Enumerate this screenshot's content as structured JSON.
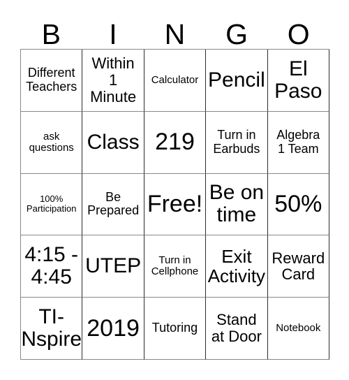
{
  "card": {
    "title_letters": [
      "B",
      "I",
      "N",
      "G",
      "O"
    ],
    "columns": 5,
    "rows": 5,
    "free_space_label": "Free!",
    "border_color": "#2b2b2b",
    "background_color": "#ffffff",
    "text_color": "#000000",
    "cells": [
      {
        "text": "Different\nTeachers",
        "size": "fs-md"
      },
      {
        "text": "Within\n1\nMinute",
        "size": "fs-lg"
      },
      {
        "text": "Calculator",
        "size": "fs-sm"
      },
      {
        "text": "Pencil",
        "size": "fs-xxl"
      },
      {
        "text": "El\nPaso",
        "size": "fs-xxl"
      },
      {
        "text": "ask\nquestions",
        "size": "fs-sm"
      },
      {
        "text": "Class",
        "size": "fs-xxl"
      },
      {
        "text": "219",
        "size": "fs-huge"
      },
      {
        "text": "Turn in\nEarbuds",
        "size": "fs-md"
      },
      {
        "text": "Algebra\n1 Team",
        "size": "fs-md"
      },
      {
        "text": "100%\nParticipation",
        "size": "fs-xs"
      },
      {
        "text": "Be\nPrepared",
        "size": "fs-md"
      },
      {
        "text": "Free!",
        "size": "fs-huge"
      },
      {
        "text": "Be on\ntime",
        "size": "fs-xxl"
      },
      {
        "text": "50%",
        "size": "fs-huge"
      },
      {
        "text": "4:15 -\n4:45",
        "size": "fs-xxl"
      },
      {
        "text": "UTEP",
        "size": "fs-xxl"
      },
      {
        "text": "Turn in\nCellphone",
        "size": "fs-sm"
      },
      {
        "text": "Exit\nActivity",
        "size": "fs-xl"
      },
      {
        "text": "Reward\nCard",
        "size": "fs-lg"
      },
      {
        "text": "TI-\nNspire",
        "size": "fs-xxl"
      },
      {
        "text": "2019",
        "size": "fs-huge"
      },
      {
        "text": "Tutoring",
        "size": "fs-md"
      },
      {
        "text": "Stand\nat Door",
        "size": "fs-lg"
      },
      {
        "text": "Notebook",
        "size": "fs-sm"
      }
    ]
  }
}
